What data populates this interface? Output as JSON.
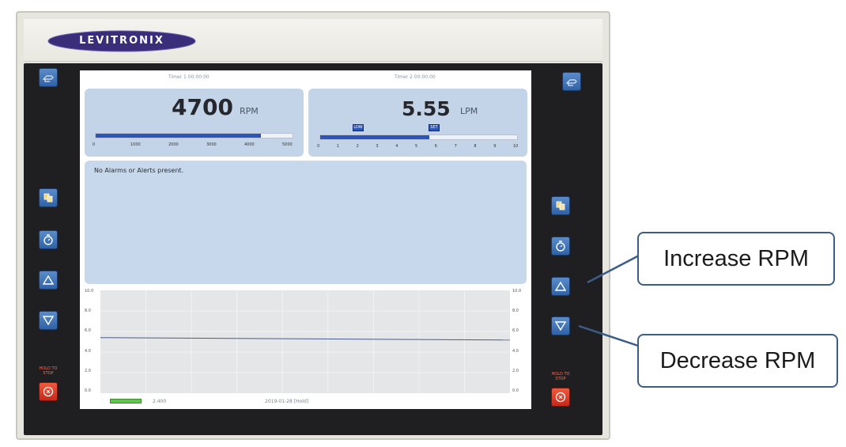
{
  "device": {
    "brand": "LEVITRONIX"
  },
  "screen": {
    "timer1": "Timer 1 00:00:00",
    "timer2": "Timer 2 00:00:00",
    "speed": {
      "value": "4700",
      "unit": "RPM",
      "fraction": 0.84,
      "ticks": [
        "0",
        "1000",
        "2000",
        "3000",
        "4000",
        "5000"
      ]
    },
    "flow": {
      "value": "5.55",
      "unit": "LPM",
      "fraction": 0.555,
      "ticks": [
        "0",
        "1",
        "2",
        "3",
        "4",
        "5",
        "6",
        "7",
        "8",
        "9",
        "10"
      ],
      "marker_low": "LOW",
      "marker_set": "SET"
    },
    "alarm_message": "No Alarms or Alerts present.",
    "trend": {
      "left_axis": [
        "10.0",
        "8.0",
        "6.0",
        "4.0",
        "2.0",
        "0.0"
      ],
      "right_axis": [
        "10.0",
        "8.0",
        "6.0",
        "4.0",
        "2.0",
        "0.0"
      ],
      "line_level": 5.4
    },
    "bottom_left": "2.400",
    "bottom_date": "2019-01-28   [Hold]"
  },
  "buttons": {
    "hold_stop_label": "HOLD TO STOP"
  },
  "callouts": {
    "increase": "Increase RPM",
    "decrease": "Decrease RPM"
  },
  "colors": {
    "button_blue": "#3b6fb3",
    "stop_red": "#d83a22",
    "panel_blue": "#c4d4e8",
    "callout_border": "#3c5d89"
  }
}
